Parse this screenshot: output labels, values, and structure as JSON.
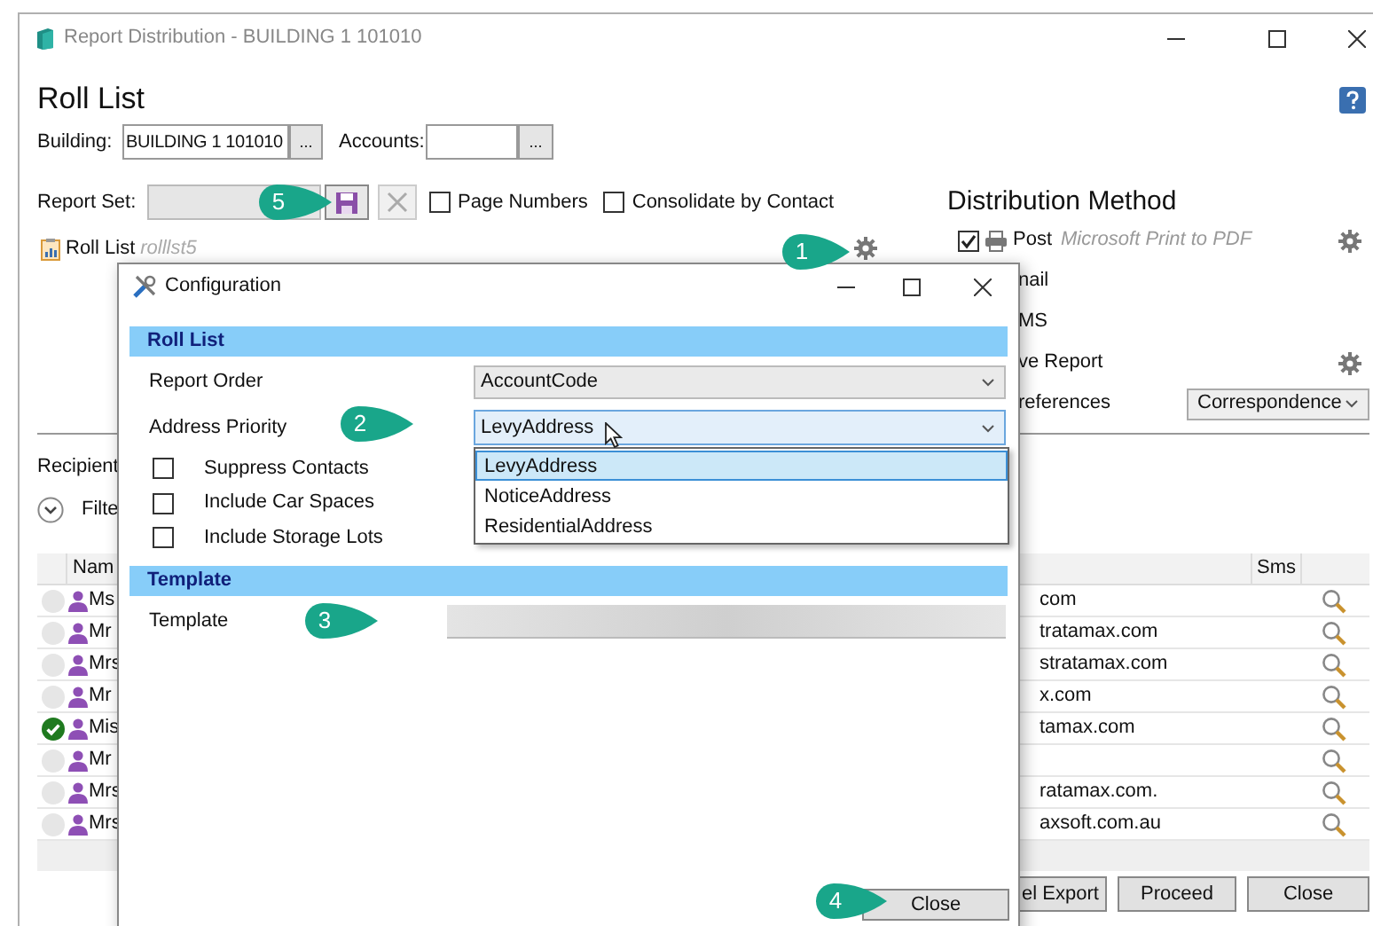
{
  "window": {
    "title": "Report Distribution - BUILDING 1 101010"
  },
  "heading": "Roll List",
  "building": {
    "label": "Building:",
    "value": "BUILDING 1 101010",
    "browse": "..."
  },
  "accounts": {
    "label": "Accounts:",
    "browse": "..."
  },
  "report_set": {
    "label": "Report Set:"
  },
  "options": [
    {
      "label": "Page Numbers",
      "checked": false
    },
    {
      "label": "Consolidate by Contact",
      "checked": false
    }
  ],
  "report": {
    "name": "Roll List",
    "code": "rolllst5"
  },
  "distribution": {
    "title": "Distribution Method",
    "methods": [
      {
        "kind": "checkbox",
        "label": "Post",
        "detail": "Microsoft Print to PDF",
        "checked": true,
        "settings": true
      },
      {
        "kind": "label",
        "label": "nail",
        "settings": false
      },
      {
        "kind": "label",
        "label": "MS",
        "settings": false
      },
      {
        "kind": "label",
        "label": "ve Report",
        "settings": true
      },
      {
        "kind": "select",
        "label": "references",
        "value": "Correspondence",
        "settings": false
      }
    ]
  },
  "recipients": {
    "label": "Recipient",
    "filter": "Filte",
    "columns": [
      "Nam",
      "Sms"
    ],
    "rows": [
      {
        "name": "Ms",
        "email": "com",
        "sent": false
      },
      {
        "name": "Mr",
        "email": "tratamax.com",
        "sent": false
      },
      {
        "name": "Mrs",
        "email": "stratamax.com",
        "sent": false
      },
      {
        "name": "Mr",
        "email": "x.com",
        "sent": false
      },
      {
        "name": "Mis",
        "email": "tamax.com",
        "sent": true
      },
      {
        "name": "Mr",
        "sent": false
      },
      {
        "name": "Mrs",
        "email": "ratamax.com.",
        "sent": false
      },
      {
        "name": "Mrs",
        "email": "axsoft.com.au",
        "sent": false
      }
    ]
  },
  "buttons": [
    "el Export",
    "Proceed",
    "Close"
  ],
  "dialog": {
    "title": "Configuration",
    "roll_list": {
      "title": "Roll List",
      "fields": [
        {
          "label": "Report Order",
          "value": "AccountCode",
          "open": false
        },
        {
          "label": "Address Priority",
          "value": "LevyAddress",
          "open": true
        }
      ],
      "options": [
        {
          "label": "LevyAddress",
          "selected": true
        },
        {
          "label": "NoticeAddress",
          "selected": false
        },
        {
          "label": "ResidentialAddress",
          "selected": false
        }
      ],
      "checkboxes": [
        {
          "label": "Suppress Contacts",
          "checked": false
        },
        {
          "label": "Include Car Spaces",
          "checked": false
        },
        {
          "label": "Include Storage Lots",
          "checked": false
        }
      ]
    },
    "template": {
      "title": "Template",
      "label": "Template"
    },
    "close": "Close"
  },
  "callouts": [
    "5",
    "1",
    "2",
    "3",
    "4"
  ]
}
